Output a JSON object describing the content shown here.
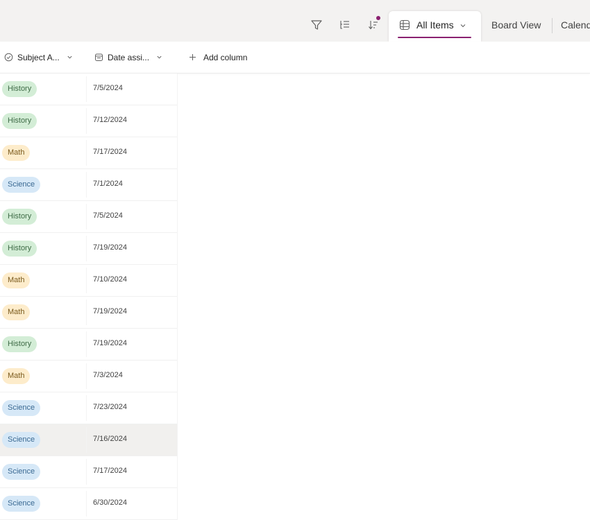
{
  "toolbar": {
    "filter_icon": "filter-icon",
    "group_icon": "list-group-icon",
    "sort_icon": "sort-icon",
    "sort_indicator_color": "#8a2070"
  },
  "views": {
    "active": {
      "label": "All Items",
      "icon": "grid-icon"
    },
    "tabs": [
      {
        "label": "Board View"
      },
      {
        "label": "Calend"
      }
    ]
  },
  "columns": {
    "subject": {
      "label": "Subject A...",
      "icon": "status-check-icon"
    },
    "date": {
      "label": "Date assi...",
      "icon": "calendar-icon"
    },
    "add": {
      "label": "Add column",
      "icon": "plus-icon"
    }
  },
  "subject_colors": {
    "History": {
      "bg": "#d3edd6",
      "fg": "#3e6b46"
    },
    "Math": {
      "bg": "#fdeccb",
      "fg": "#7a5a1c"
    },
    "Science": {
      "bg": "#d6e8f7",
      "fg": "#3b6a93"
    }
  },
  "rows": [
    {
      "subject": "History",
      "date": "7/5/2024"
    },
    {
      "subject": "History",
      "date": "7/12/2024"
    },
    {
      "subject": "Math",
      "date": "7/17/2024"
    },
    {
      "subject": "Science",
      "date": "7/1/2024"
    },
    {
      "subject": "History",
      "date": "7/5/2024"
    },
    {
      "subject": "History",
      "date": "7/19/2024"
    },
    {
      "subject": "Math",
      "date": "7/10/2024"
    },
    {
      "subject": "Math",
      "date": "7/19/2024"
    },
    {
      "subject": "History",
      "date": "7/19/2024"
    },
    {
      "subject": "Math",
      "date": "7/3/2024"
    },
    {
      "subject": "Science",
      "date": "7/23/2024"
    },
    {
      "subject": "Science",
      "date": "7/16/2024",
      "selected": true
    },
    {
      "subject": "Science",
      "date": "7/17/2024"
    },
    {
      "subject": "Science",
      "date": "6/30/2024"
    }
  ]
}
